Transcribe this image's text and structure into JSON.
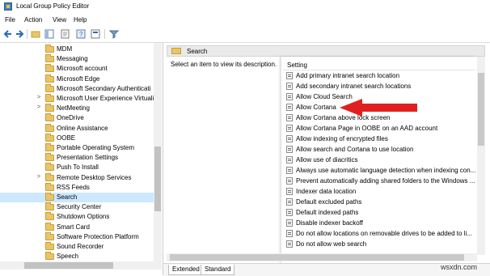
{
  "window": {
    "title": "Local Group Policy Editor"
  },
  "menu": {
    "file": "File",
    "action": "Action",
    "view": "View",
    "help": "Help"
  },
  "toolbar": {
    "icons": [
      "back-icon",
      "forward-icon",
      "up-folder-icon",
      "show-hide-tree-icon",
      "export-icon",
      "help-icon",
      "properties-icon",
      "filter-icon"
    ]
  },
  "tree": {
    "items": [
      {
        "label": "MDM",
        "expandable": false
      },
      {
        "label": "Messaging",
        "expandable": false
      },
      {
        "label": "Microsoft account",
        "expandable": false
      },
      {
        "label": "Microsoft Edge",
        "expandable": false
      },
      {
        "label": "Microsoft Secondary Authenticati",
        "expandable": false
      },
      {
        "label": "Microsoft User Experience Virtuali",
        "expandable": true
      },
      {
        "label": "NetMeeting",
        "expandable": true
      },
      {
        "label": "OneDrive",
        "expandable": false
      },
      {
        "label": "Online Assistance",
        "expandable": false
      },
      {
        "label": "OOBE",
        "expandable": false
      },
      {
        "label": "Portable Operating System",
        "expandable": false
      },
      {
        "label": "Presentation Settings",
        "expandable": false
      },
      {
        "label": "Push To Install",
        "expandable": false
      },
      {
        "label": "Remote Desktop Services",
        "expandable": true
      },
      {
        "label": "RSS Feeds",
        "expandable": false
      },
      {
        "label": "Search",
        "expandable": false,
        "selected": true
      },
      {
        "label": "Security Center",
        "expandable": false
      },
      {
        "label": "Shutdown Options",
        "expandable": false
      },
      {
        "label": "Smart Card",
        "expandable": false
      },
      {
        "label": "Software Protection Platform",
        "expandable": false
      },
      {
        "label": "Sound Recorder",
        "expandable": false
      },
      {
        "label": "Speech",
        "expandable": false
      }
    ]
  },
  "panel": {
    "header": "Search",
    "description": "Select an item to view its description.",
    "column_header": "Setting"
  },
  "settings": [
    "Add primary intranet search location",
    "Add secondary intranet search locations",
    "Allow Cloud Search",
    "Allow Cortana",
    "Allow Cortana above lock screen",
    "Allow Cortana Page in OOBE on an AAD account",
    "Allow indexing of encrypted files",
    "Allow search and Cortana to use location",
    "Allow use of diacritics",
    "Always use automatic language detection when indexing con...",
    "Prevent automatically adding shared folders to the Windows ...",
    "Indexer data location",
    "Default excluded paths",
    "Default indexed paths",
    "Disable indexer backoff",
    "Do not allow locations on removable drives to be added to li...",
    "Do not allow web search"
  ],
  "tabs": {
    "extended": "Extended",
    "standard": "Standard"
  },
  "watermark": "wsxdn.com",
  "colors": {
    "selection": "#cce8ff",
    "arrow": "#e02020",
    "folder": "#e9c46a"
  }
}
